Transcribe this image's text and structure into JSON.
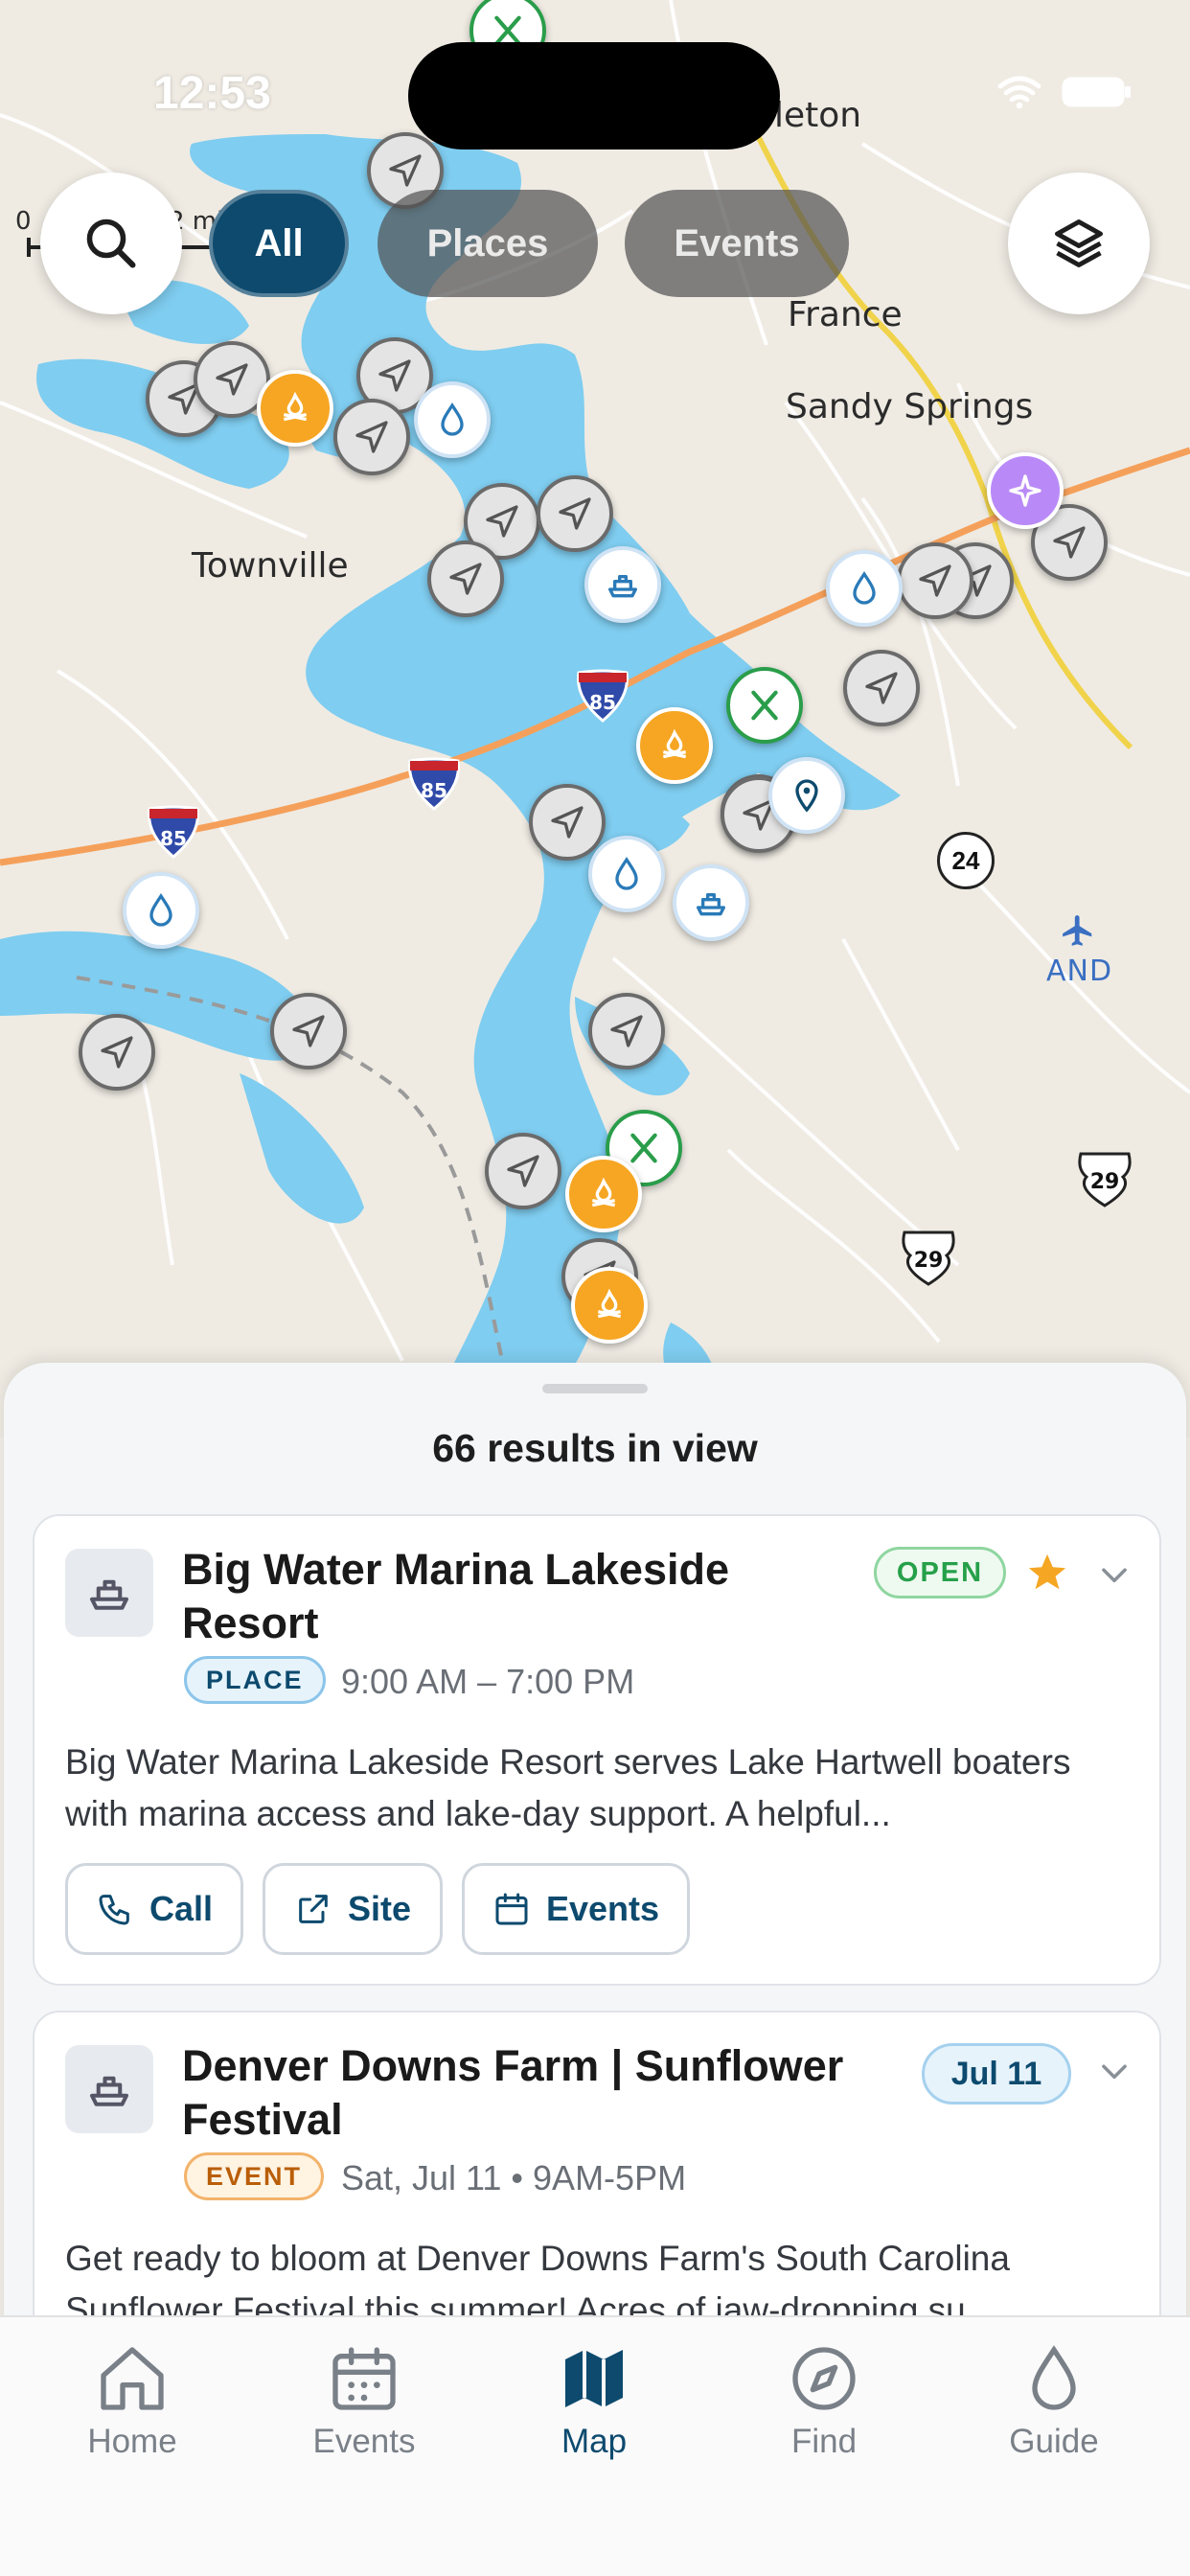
{
  "status_bar": {
    "time": "12:53"
  },
  "map": {
    "places": [
      {
        "name": "Townville"
      },
      {
        "name": "France"
      },
      {
        "name": "Sandy Springs"
      },
      {
        "name": "AND"
      },
      {
        "name": "leton"
      }
    ],
    "highway_labels": [
      "85",
      "85",
      "85",
      "24",
      "29",
      "29"
    ],
    "scale": {
      "zero": "0",
      "unit": "2 mi"
    }
  },
  "filters": {
    "all": "All",
    "places": "Places",
    "events": "Events",
    "active": "All"
  },
  "sheet": {
    "results_count": "66 results in view",
    "cards": [
      {
        "title": "Big Water Marina Lakeside Resort",
        "tag": "PLACE",
        "hours": "9:00 AM – 7:00 PM",
        "status": "OPEN",
        "favorite": true,
        "description": "Big Water Marina Lakeside Resort serves Lake Hartwell boaters with marina access and lake-day support. A helpful...",
        "actions": {
          "call": "Call",
          "site": "Site",
          "events": "Events"
        }
      },
      {
        "title": "Denver Downs Farm | Sunflower Festival",
        "tag": "EVENT",
        "hours": "Sat, Jul 11 • 9AM-5PM",
        "date_badge": "Jul 11",
        "description": "Get ready to bloom at Denver Downs Farm's South Carolina Sunflower Festival this summer! Acres of jaw-dropping su..."
      }
    ]
  },
  "tabbar": {
    "items": [
      {
        "label": "Home",
        "icon": "home-icon"
      },
      {
        "label": "Events",
        "icon": "calendar-icon"
      },
      {
        "label": "Map",
        "icon": "map-icon"
      },
      {
        "label": "Find",
        "icon": "compass-icon"
      },
      {
        "label": "Guide",
        "icon": "drop-icon"
      }
    ],
    "active": "Map"
  },
  "colors": {
    "accent": "#0d4a6e",
    "water": "#7fcdf0",
    "land": "#efebe3",
    "interstate": "#f5a05a",
    "open_green": "#26a04a",
    "star": "#f5a623"
  }
}
